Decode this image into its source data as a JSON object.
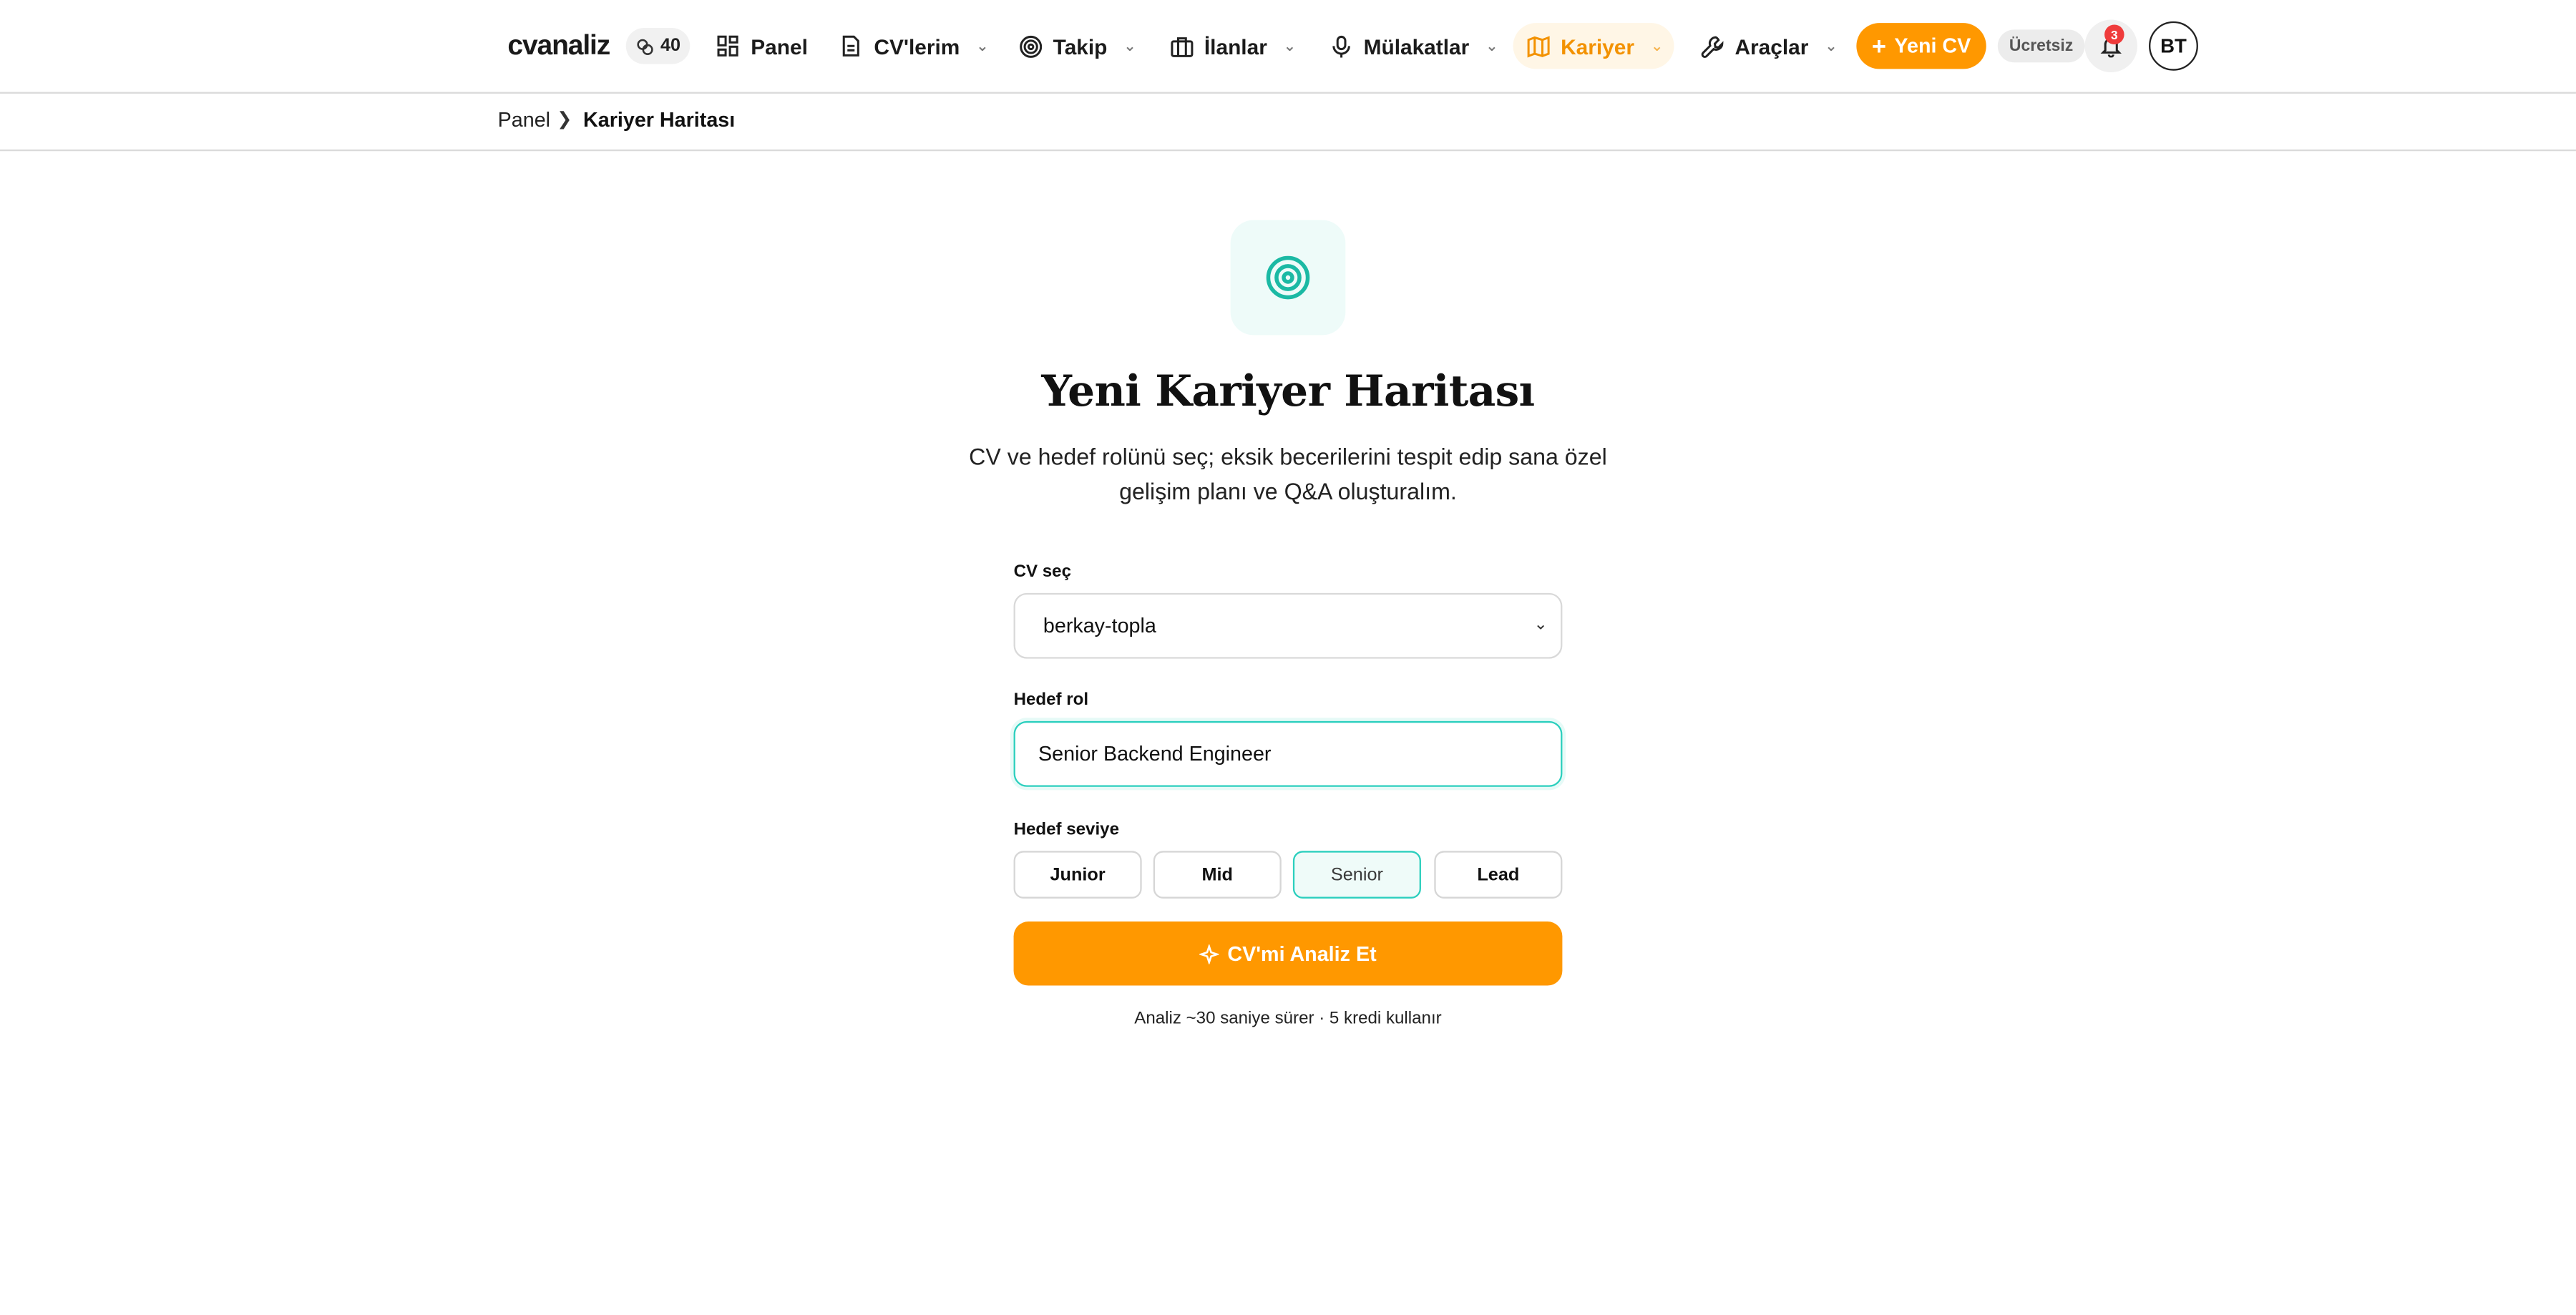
{
  "nav": {
    "logo": "cvanaliz",
    "credits": "40",
    "items": [
      {
        "label": "Panel",
        "icon": "grid-icon",
        "dropdown": false,
        "active": false
      },
      {
        "label": "CV'lerim",
        "icon": "document-icon",
        "dropdown": true,
        "active": false
      },
      {
        "label": "Takip",
        "icon": "target-icon",
        "dropdown": true,
        "active": false
      },
      {
        "label": "İlanlar",
        "icon": "briefcase-icon",
        "dropdown": true,
        "active": false
      },
      {
        "label": "Mülakatlar",
        "icon": "microphone-icon",
        "dropdown": true,
        "active": false
      },
      {
        "label": "Kariyer",
        "icon": "map-icon",
        "dropdown": true,
        "active": true
      },
      {
        "label": "Araçlar",
        "icon": "wrench-icon",
        "dropdown": true,
        "active": false
      }
    ],
    "new_cv_label": "Yeni CV",
    "plan_badge": "Ücretsiz",
    "notification_count": "3",
    "avatar_initials": "BT"
  },
  "breadcrumb": {
    "items": [
      "Panel",
      "Kariyer Haritası"
    ]
  },
  "hero": {
    "icon": "target-icon",
    "title": "Yeni Kariyer Haritası",
    "subtitle": "CV ve hedef rolünü seç; eksik becerilerini tespit edip sana özel gelişim planı ve Q&A oluşturalım."
  },
  "form": {
    "cv_label": "CV seç",
    "cv_selected": "berkay-topla",
    "role_label": "Hedef rol",
    "role_value": "Senior Backend Engineer",
    "level_label": "Hedef seviye",
    "levels": [
      "Junior",
      "Mid",
      "Senior",
      "Lead"
    ],
    "selected_level": "Senior",
    "submit_label": "CV'mi Analiz Et",
    "note": "Analiz ~30 saniye sürer · 5 kredi kullanır"
  },
  "colors": {
    "accent": "#ff9800",
    "teal": "#2ccfbe",
    "badge_red": "#ef3b3b"
  }
}
